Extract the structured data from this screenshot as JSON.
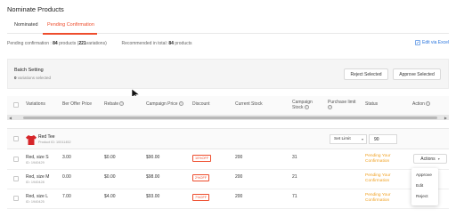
{
  "page": {
    "title": "Nominate Products"
  },
  "tabs": [
    {
      "label": "Nominated"
    },
    {
      "label": "Pending Confirmation"
    }
  ],
  "summary": {
    "pending_label": "Pending confirmation :",
    "pending_products": "84",
    "products_word": "products (",
    "pending_variations": "221",
    "variations_word": "variations)",
    "recommended_label": "Recommended in total:",
    "recommended_products": "84",
    "recommended_word": "products",
    "edit_excel_label": "Edit via Excel"
  },
  "batch": {
    "title": "Batch Setting",
    "selected_count": "0",
    "selected_text": "variations selected",
    "reject_label": "Reject Selected",
    "approve_label": "Approve Selected"
  },
  "columns": [
    "Variations",
    "Ber Offer Price",
    "Rebate",
    "Campaign Price",
    "Discount",
    "Current Stock",
    "Campaign",
    "Stock",
    "Purchase limit",
    "Status",
    "Action"
  ],
  "product": {
    "name": "Red Tee",
    "id": "Product ID: 10011452",
    "limit_select": "Set Limit",
    "limit_value": "90"
  },
  "rows": [
    {
      "name": "Red, size S",
      "id": "ID: 1940429",
      "offer": "3.00",
      "rebate": "$0.00",
      "campaign_price": "$90.00",
      "discount": "10%OFF",
      "stock": "200",
      "campaign_stock": "31",
      "status_line1": "Pending Your",
      "status_line2": "Confirmation"
    },
    {
      "name": "Red, size M",
      "id": "ID: 1940428",
      "offer": "0.00",
      "rebate": "$0.00",
      "campaign_price": "$98.00",
      "discount": "2%OFF",
      "stock": "200",
      "campaign_stock": "21",
      "status_line1": "Pending Your",
      "status_line2": "Confirmation"
    },
    {
      "name": "Red, size L",
      "id": "ID: 1940425",
      "offer": "7.00",
      "rebate": "$4.00",
      "campaign_price": "$93.00",
      "discount": "7%OFF",
      "stock": "200",
      "campaign_stock": "71",
      "status_line1": "Pending Your",
      "status_line2": "Confirmation"
    }
  ],
  "actions": {
    "button_label": "Actions",
    "menu": [
      "Approve",
      "Edit",
      "Reject"
    ]
  },
  "colors": {
    "accent": "#ee4d2d",
    "link": "#2673dd",
    "pending": "#f0a020"
  }
}
